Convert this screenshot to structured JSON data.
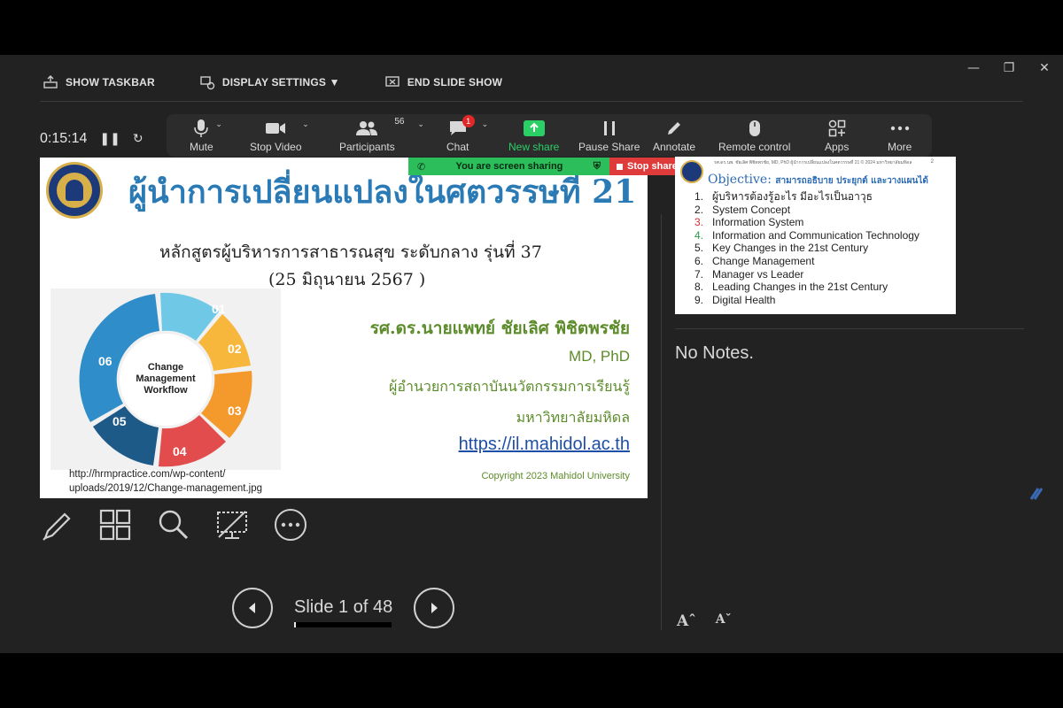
{
  "topbar": {
    "show_taskbar": "SHOW TASKBAR",
    "display_settings": "DISPLAY SETTINGS ▼",
    "end_slide_show": "END SLIDE SHOW"
  },
  "timer": {
    "elapsed": "0:15:14"
  },
  "toolbar": {
    "mute": "Mute",
    "stop_video": "Stop Video",
    "participants": "Participants",
    "participants_count": "56",
    "chat": "Chat",
    "chat_badge": "1",
    "new_share": "New share",
    "pause_share": "Pause Share",
    "annotate": "Annotate",
    "remote_control": "Remote control",
    "apps": "Apps",
    "more": "More"
  },
  "share_banner": {
    "status": "You are screen sharing",
    "stop": "Stop share"
  },
  "slide": {
    "title": "ผู้นำการเปลี่ยนแปลงในศตวรรษที่ 21",
    "subtitle": "หลักสูตรผู้บริหารการสาธารณสุข ระดับกลาง รุ่นที่ 37",
    "date": "(25 มิถุนายน 2567 )",
    "wheel_center": [
      "Change",
      "Management",
      "Workflow"
    ],
    "wheel_numbers": [
      "01",
      "02",
      "03",
      "04",
      "05",
      "06"
    ],
    "citation_line1": "http://hrmpractice.com/wp-content/",
    "citation_line2": "uploads/2019/12/Change-management.jpg",
    "presenter": "รศ.ดร.นายแพทย์ ชัยเลิศ พิชิตพรชัย",
    "degree": "MD, PhD",
    "role": "ผู้อำนวยการสถาบันนวัตกรรมการเรียนรู้",
    "org": "มหาวิทยาลัยมหิดล",
    "url": "https://il.mahidol.ac.th",
    "copyright": "Copyright 2023 Mahidol University"
  },
  "navigation": {
    "counter": "Slide 1 of 48",
    "current": 1,
    "total": 48
  },
  "next_slide": {
    "header": "รศ.ดร.นพ. ชัยเลิศ พิชิตพรชัย, MD, PhD      ผู้นำการเปลี่ยนแปลงในศตวรรษที่ 21      © 2024 มหาวิทยาลัยมหิดล",
    "page_num": "2",
    "objective_label": "Objective:",
    "objective_text": "สามารถอธิบาย ประยุกต์ และวางแผนได้",
    "items": [
      "ผู้บริหารต้องรู้อะไร มีอะไรเป็นอาวุธ",
      "System Concept",
      "Information System",
      "Information and Communication Technology",
      "Key Changes in the 21st Century",
      "Change Management",
      "Manager vs Leader",
      "Leading Changes in the 21st Century",
      "Digital Health"
    ]
  },
  "notes": {
    "text": "No Notes."
  },
  "colors": {
    "background": "#222222",
    "new_share_green": "#2ad066",
    "banner_green": "#2bbe5a",
    "stop_red": "#e03b3b",
    "title_blue": "#2a7ab5",
    "presenter_green": "#5c8c2a"
  }
}
